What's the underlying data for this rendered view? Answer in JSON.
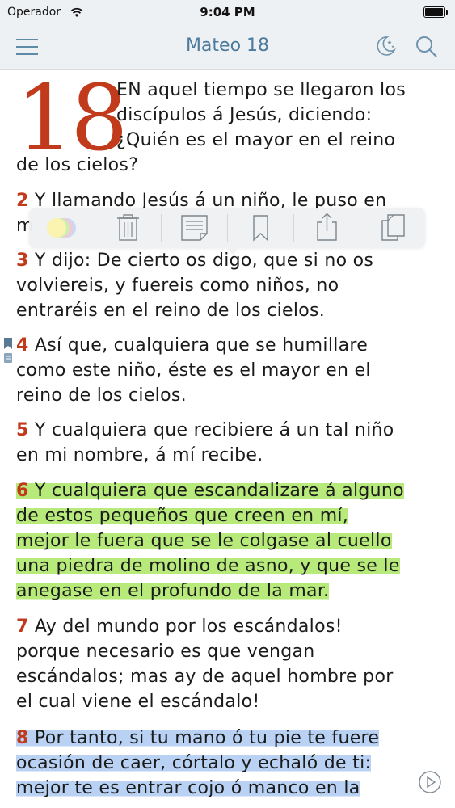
{
  "status": {
    "carrier": "Operador",
    "time": "9:04 PM"
  },
  "nav": {
    "title": "Mateo 18"
  },
  "chapter": {
    "number": "18"
  },
  "verses": [
    {
      "num": "",
      "lines": [
        "EN aquel tiempo se llegaron los",
        "discípulos á Jesús, diciendo:",
        "¿Quién es el mayor en el reino",
        "de los cielos?"
      ]
    },
    {
      "num": "2",
      "text": "Y llamando Jesús á un niño, le puso en",
      "text2": "m"
    },
    {
      "num": "3",
      "lines": [
        "Y dijo: De cierto os digo, que si no os",
        "volviereis, y fuereis como niños, no",
        "entraréis en el reino de los cielos."
      ]
    },
    {
      "num": "4",
      "lines": [
        "Así que, cualquiera que se humillare",
        "como este niño, éste es el mayor en el",
        "reino de los cielos."
      ]
    },
    {
      "num": "5",
      "lines": [
        "Y cualquiera que recibiere á un tal niño",
        "en mi nombre, á mí recibe."
      ]
    },
    {
      "num": "6",
      "highlight": "green",
      "lines": [
        "Y cualquiera que escandalizare á alguno",
        "de estos pequeños que creen en mí,",
        "mejor le fuera que se le colgase al cuello",
        "una piedra de molino de asno, y que se le",
        "anegase en el profundo de la mar."
      ]
    },
    {
      "num": "7",
      "lines": [
        "Ay del mundo por los escándalos!",
        "porque necesario es que vengan",
        "escándalos; mas ay de aquel hombre por",
        "el cual viene el escándalo!"
      ]
    },
    {
      "num": "8",
      "highlight": "blue",
      "lines": [
        "Por tanto, si tu mano ó tu pie te fuere",
        "ocasión de caer, córtalo y echaló de ti:",
        "mejor te es entrar cojo ó manco en la"
      ]
    }
  ],
  "popup": {
    "tools": [
      {
        "name": "highlight-color-picker",
        "icon": "color-circles-icon"
      },
      {
        "name": "delete-button",
        "icon": "trash-icon"
      },
      {
        "name": "note-button",
        "icon": "note-icon"
      },
      {
        "name": "bookmark-button",
        "icon": "bookmark-icon"
      },
      {
        "name": "share-button",
        "icon": "share-icon"
      },
      {
        "name": "copy-button",
        "icon": "copy-icon"
      }
    ]
  },
  "colors": {
    "accent": "#4c7b9e",
    "verse_number": "#c23a1c",
    "highlight_green": "#b7ea7a",
    "highlight_blue": "#b9d2f3"
  }
}
